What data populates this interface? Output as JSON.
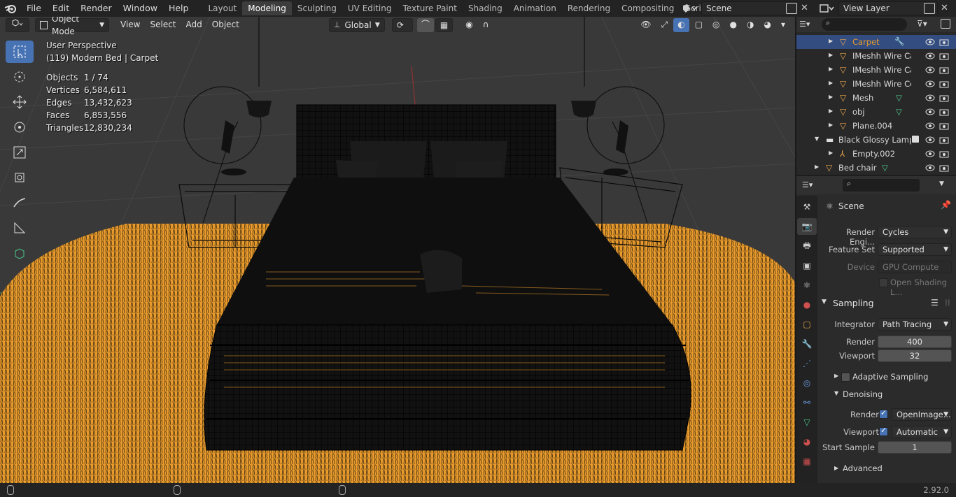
{
  "topbar": {
    "menus": [
      "File",
      "Edit",
      "Render",
      "Window",
      "Help"
    ],
    "tabs": [
      "Layout",
      "Modeling",
      "Sculpting",
      "UV Editing",
      "Texture Paint",
      "Shading",
      "Animation",
      "Rendering",
      "Compositing",
      "Scripting"
    ],
    "active_tab": "Modeling",
    "scene": "Scene",
    "view_layer": "View Layer"
  },
  "viewport": {
    "header": {
      "mode": "Object Mode",
      "menus": [
        "View",
        "Select",
        "Add",
        "Object"
      ],
      "orientation": "Global"
    },
    "view_name": "User Perspective",
    "active_object": "(119) Modern Bed | Carpet",
    "stats": [
      {
        "k": "Objects",
        "v": "1 / 74"
      },
      {
        "k": "Vertices",
        "v": "6,584,611"
      },
      {
        "k": "Edges",
        "v": "13,432,623"
      },
      {
        "k": "Faces",
        "v": "6,853,556"
      },
      {
        "k": "Triangles",
        "v": "12,830,234"
      }
    ]
  },
  "outliner": {
    "rows": [
      {
        "name": "Carpet",
        "type": "mesh",
        "selected": true,
        "indent": 1
      },
      {
        "name": "IMeshh Wire Ca",
        "type": "mesh",
        "indent": 1
      },
      {
        "name": "IMeshh Wire Ca",
        "type": "mesh",
        "indent": 1
      },
      {
        "name": "IMeshh Wire Cc",
        "type": "mesh",
        "indent": 1
      },
      {
        "name": "Mesh",
        "type": "mesh",
        "indent": 1,
        "data": true
      },
      {
        "name": "obj",
        "type": "mesh",
        "indent": 1,
        "data": true
      },
      {
        "name": "Plane.004",
        "type": "mesh",
        "indent": 1
      },
      {
        "name": "Black Glossy Lamp",
        "type": "collection",
        "indent": 0
      },
      {
        "name": "Empty.002",
        "type": "empty",
        "indent": 1
      },
      {
        "name": "Bed chair",
        "type": "mesh",
        "indent": 0,
        "data": true
      }
    ]
  },
  "properties": {
    "context": "Scene",
    "render_engine_label": "Render Engi...",
    "render_engine": "Cycles",
    "feature_set_label": "Feature Set",
    "feature_set": "Supported",
    "device_label": "Device",
    "device": "GPU Compute",
    "open_shading_label": "Open Shading L...",
    "sampling": {
      "title": "Sampling",
      "integrator_label": "Integrator",
      "integrator": "Path Tracing",
      "render_label": "Render",
      "render": "400",
      "viewport_label": "Viewport",
      "viewport": "32"
    },
    "adaptive_label": "Adaptive Sampling",
    "denoising": {
      "title": "Denoising",
      "render_label": "Render",
      "render": "OpenImage...",
      "viewport_label": "Viewport",
      "viewport": "Automatic",
      "start_label": "Start Sample",
      "start": "1"
    },
    "advanced_label": "Advanced"
  },
  "statusbar": {
    "version": "2.92.0"
  },
  "colors": {
    "accent": "#4772b3",
    "selection": "#334d80",
    "carpet": "#e89a2c",
    "mesh_icon": "#e8a34c",
    "data_icon": "#4cc88c"
  }
}
